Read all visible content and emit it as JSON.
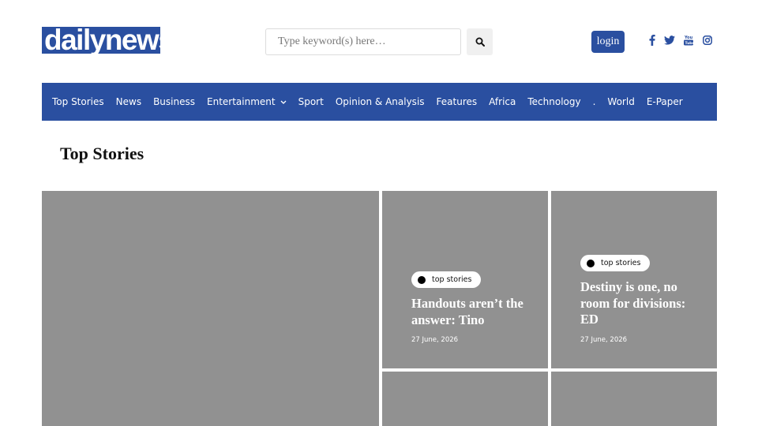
{
  "header": {
    "logo_text": "dailynews",
    "search": {
      "placeholder": "Type keyword(s) here…",
      "value": ""
    },
    "search_icon": "search-icon",
    "login_label": "login",
    "social": [
      "facebook-icon",
      "twitter-icon",
      "youtube-icon",
      "instagram-icon"
    ],
    "brand_color": "#2a4fa0"
  },
  "nav": {
    "items": [
      {
        "label": "Top Stories"
      },
      {
        "label": "News"
      },
      {
        "label": "Business"
      },
      {
        "label": "Entertainment",
        "has_dropdown": true
      },
      {
        "label": "Sport"
      },
      {
        "label": "Opinion & Analysis"
      },
      {
        "label": "Features"
      },
      {
        "label": "Africa"
      },
      {
        "label": "Technology"
      },
      {
        "label": "."
      },
      {
        "label": "World"
      },
      {
        "label": "E-Paper"
      }
    ]
  },
  "section": {
    "title": "Top Stories"
  },
  "stories": [
    {
      "tag": "top stories",
      "headline": "Handouts aren’t the answer: Tino",
      "date": "27 June, 2026"
    },
    {
      "tag": "top stories",
      "headline": "Destiny is one, no room for divisions: ED",
      "date": "27 June, 2026"
    }
  ],
  "tile_color": "#919191"
}
